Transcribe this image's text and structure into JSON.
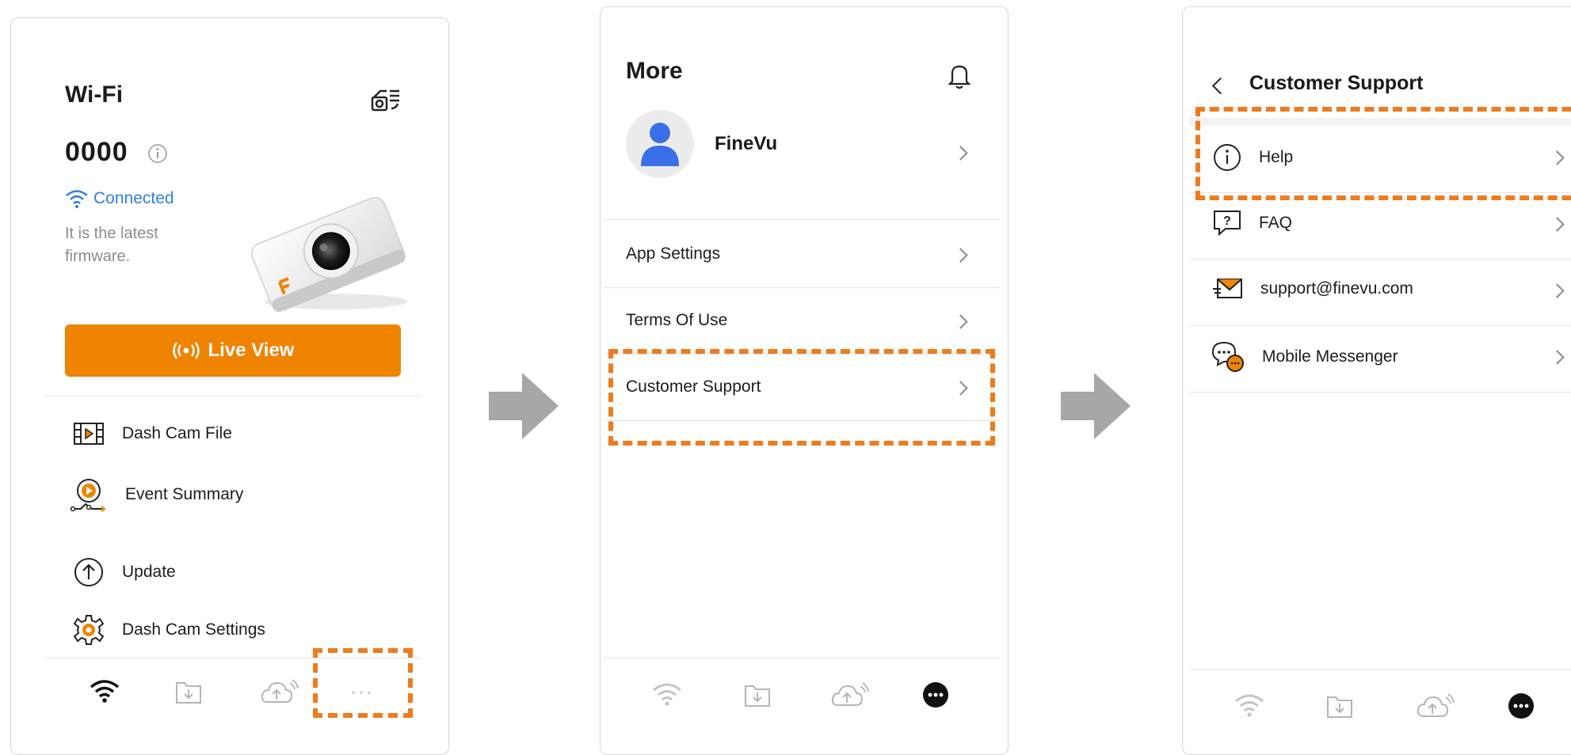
{
  "screen1": {
    "title": "Wi-Fi",
    "device_name": "0000",
    "status": "Connected",
    "firmware_note_line1": "It is the latest",
    "firmware_note_line2": "firmware.",
    "live_view": "Live View",
    "menu": [
      {
        "label": "Dash Cam File",
        "icon": "film-icon"
      },
      {
        "label": "Event Summary",
        "icon": "event-play-icon"
      },
      {
        "label": "Update",
        "icon": "upload-arrow-icon"
      },
      {
        "label": "Dash Cam Settings",
        "icon": "gear-icon"
      }
    ],
    "more_dots": "···"
  },
  "screen2": {
    "title": "More",
    "profile_name": "FineVu",
    "items": [
      {
        "label": "App Settings"
      },
      {
        "label": "Terms Of Use"
      },
      {
        "label": "Customer Support"
      }
    ]
  },
  "screen3": {
    "title": "Customer Support",
    "items": [
      {
        "label": "Help",
        "icon": "info-icon"
      },
      {
        "label": "FAQ",
        "icon": "faq-icon"
      },
      {
        "label": "support@finevu.com",
        "icon": "mail-icon"
      },
      {
        "label": "Mobile Messenger",
        "icon": "chat-icon"
      }
    ]
  },
  "colors": {
    "accent": "#f08300",
    "highlight": "#ef7b1e",
    "link": "#2f7fe0"
  }
}
